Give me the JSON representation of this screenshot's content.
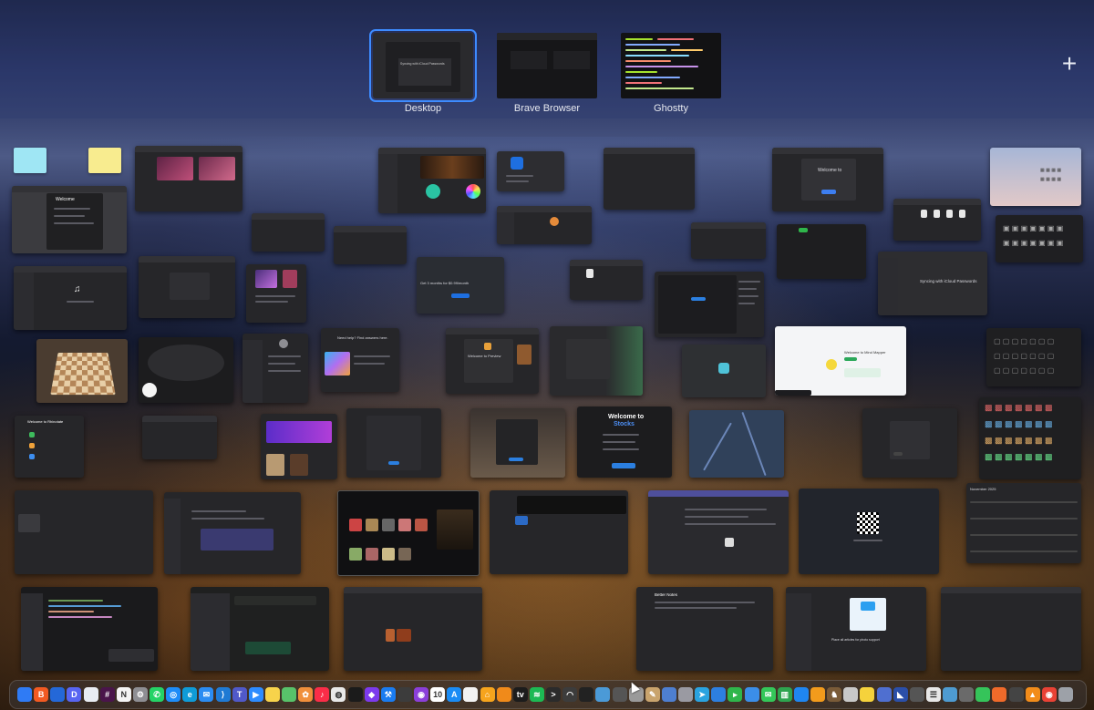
{
  "spaces": [
    {
      "label": "Desktop",
      "active": true,
      "thumb_text": "Syncing with iCloud Passwords"
    },
    {
      "label": "Brave Browser",
      "active": false
    },
    {
      "label": "Ghostty",
      "active": false
    }
  ],
  "add_space_label": "+",
  "windows": {
    "rhinotate_title": "Welcome to Rhinotate",
    "stocks_title": "Welcome to",
    "stocks_brand": "Stocks",
    "tv_title": "Get 3 months for $0.99/month",
    "icloud_text": "Syncing with iCloud Passwords",
    "preview_text": "Welcome to Preview",
    "pages_text": "Need help? Find answers here.",
    "mindmap_title": "Welcome to Mind Mapper",
    "better_notes_title": "Better Notes",
    "calendar_month": "November 2025",
    "support_text": "Place all articles for photo support"
  },
  "dock_icons": [
    {
      "name": "finder-icon",
      "color": "#2f7bf5",
      "glyph": ""
    },
    {
      "name": "brave-icon",
      "color": "#f25a22",
      "glyph": "B"
    },
    {
      "name": "notes-list-icon",
      "color": "#2468d8",
      "glyph": ""
    },
    {
      "name": "discord-icon",
      "color": "#5865f2",
      "glyph": "D"
    },
    {
      "name": "launchpad-icon",
      "color": "#e8ecf2",
      "glyph": ""
    },
    {
      "name": "slack-icon",
      "color": "#4a154b",
      "glyph": "#"
    },
    {
      "name": "notion-icon",
      "color": "#f4f4f4",
      "glyph": "N"
    },
    {
      "name": "settings-icon",
      "color": "#8e8e93",
      "glyph": "⚙"
    },
    {
      "name": "whatsapp-icon",
      "color": "#25d366",
      "glyph": "✆"
    },
    {
      "name": "safari-icon",
      "color": "#1d8cf8",
      "glyph": "◎"
    },
    {
      "name": "edge-icon",
      "color": "#0f9bd7",
      "glyph": "e"
    },
    {
      "name": "mail-icon",
      "color": "#2b8cf2",
      "glyph": "✉"
    },
    {
      "name": "vscode-icon",
      "color": "#1f7ad4",
      "glyph": "⟩"
    },
    {
      "name": "teams-icon",
      "color": "#5059c9",
      "glyph": "T"
    },
    {
      "name": "zoom-icon",
      "color": "#2d8cff",
      "glyph": "▶"
    },
    {
      "name": "notes-icon",
      "color": "#f7d34b",
      "glyph": ""
    },
    {
      "name": "maps-icon",
      "color": "#58c26a",
      "glyph": ""
    },
    {
      "name": "photos-icon",
      "color": "#f08f3b",
      "glyph": "✿"
    },
    {
      "name": "music-icon",
      "color": "#fa2d48",
      "glyph": "♪"
    },
    {
      "name": "chatgpt-icon",
      "color": "#e8e8e8",
      "glyph": "◍"
    },
    {
      "name": "github-icon",
      "color": "#1b1b1b",
      "glyph": ""
    },
    {
      "name": "obsidian-icon",
      "color": "#7c3aed",
      "glyph": "◆"
    },
    {
      "name": "xcode-icon",
      "color": "#1a7cf0",
      "glyph": "⚒"
    },
    {
      "name": "simulator-icon",
      "color": "#3c3c3c",
      "glyph": ""
    },
    {
      "name": "podcasts-icon",
      "color": "#8b3fd9",
      "glyph": "◉"
    },
    {
      "name": "calendar-icon",
      "color": "#ffffff",
      "glyph": "10"
    },
    {
      "name": "appstore-icon",
      "color": "#1a8cf5",
      "glyph": "A"
    },
    {
      "name": "reminders-icon",
      "color": "#f2f2f2",
      "glyph": ""
    },
    {
      "name": "home-icon",
      "color": "#f6a41d",
      "glyph": "⌂"
    },
    {
      "name": "books-icon",
      "color": "#f08a1a",
      "glyph": ""
    },
    {
      "name": "appletv-icon",
      "color": "#1c1c1c",
      "glyph": "tv"
    },
    {
      "name": "spotify-icon",
      "color": "#1db954",
      "glyph": "≋"
    },
    {
      "name": "terminal-icon",
      "color": "#2b2b2b",
      "glyph": ">"
    },
    {
      "name": "wifi-icon",
      "color": "#3c3c3c",
      "glyph": "◠"
    },
    {
      "name": "activity-icon",
      "color": "#222222",
      "glyph": ""
    },
    {
      "name": "preview-icon",
      "color": "#4b9ad7",
      "glyph": ""
    },
    {
      "name": "print-icon",
      "color": "#555555",
      "glyph": ""
    },
    {
      "name": "disk-icon",
      "color": "#9a9a9a",
      "glyph": ""
    },
    {
      "name": "brush-icon",
      "color": "#c9a46d",
      "glyph": "✎"
    },
    {
      "name": "weather-icon",
      "color": "#4e7fd0",
      "glyph": ""
    },
    {
      "name": "keychain-icon",
      "color": "#9a9aa2",
      "glyph": ""
    },
    {
      "name": "telegram-icon",
      "color": "#2aa3e0",
      "glyph": "➤"
    },
    {
      "name": "messages-blue-icon",
      "color": "#2d7fe0",
      "glyph": ""
    },
    {
      "name": "facetime-icon",
      "color": "#2fb64b",
      "glyph": "▸"
    },
    {
      "name": "finder2-icon",
      "color": "#3b8ee8",
      "glyph": ""
    },
    {
      "name": "messages-icon",
      "color": "#34c759",
      "glyph": "✉"
    },
    {
      "name": "numbers-icon",
      "color": "#2ea44f",
      "glyph": "▥"
    },
    {
      "name": "keynote-icon",
      "color": "#1f86f0",
      "glyph": ""
    },
    {
      "name": "pages-icon",
      "color": "#f29b1c",
      "glyph": ""
    },
    {
      "name": "chess-icon",
      "color": "#7a5b38",
      "glyph": "♞"
    },
    {
      "name": "font-icon",
      "color": "#c8c8c8",
      "glyph": ""
    },
    {
      "name": "stickies-icon",
      "color": "#f5d23c",
      "glyph": ""
    },
    {
      "name": "mindmap-icon",
      "color": "#4f6fd0",
      "glyph": ""
    },
    {
      "name": "affinity-icon",
      "color": "#2b4fa8",
      "glyph": "◣"
    },
    {
      "name": "grid-icon",
      "color": "#555555",
      "glyph": ""
    },
    {
      "name": "checklist-icon",
      "color": "#e7e7e7",
      "glyph": "☰"
    },
    {
      "name": "mindnode-icon",
      "color": "#4e9bd1",
      "glyph": ""
    },
    {
      "name": "pen-icon",
      "color": "#6a6a6a",
      "glyph": ""
    },
    {
      "name": "messages3-icon",
      "color": "#35c45a",
      "glyph": ""
    },
    {
      "name": "orange-app-icon",
      "color": "#f06a2a",
      "glyph": ""
    },
    {
      "name": "script-icon",
      "color": "#444444",
      "glyph": ""
    },
    {
      "name": "vlc-icon",
      "color": "#f28c1a",
      "glyph": "▲"
    },
    {
      "name": "chrome-icon",
      "color": "#e94235",
      "glyph": "◉"
    },
    {
      "name": "trash-icon",
      "color": "#9da1a8",
      "glyph": ""
    }
  ]
}
